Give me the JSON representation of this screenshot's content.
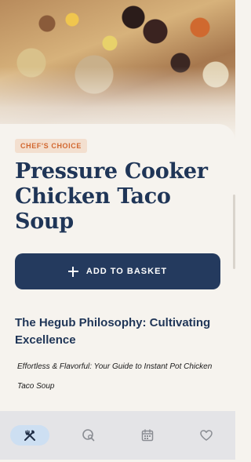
{
  "recipe": {
    "badge": "CHEF'S CHOICE",
    "title": "Pressure Cooker Chicken Taco Soup",
    "add_button_label": "ADD TO BASKET",
    "section_title": "The Hegub Philosophy: Cultivating Excellence",
    "subtitle": "Effortless & Flavorful: Your Guide to Instant Pot Chicken Taco Soup"
  },
  "bottom_nav": {
    "items": [
      {
        "icon": "utensils-icon",
        "active": true
      },
      {
        "icon": "search-recipes-icon",
        "active": false
      },
      {
        "icon": "calendar-icon",
        "active": false
      },
      {
        "icon": "heart-icon",
        "active": false
      }
    ]
  },
  "colors": {
    "primary": "#243a5e",
    "title": "#1f3557",
    "badge_text": "#d2672f",
    "badge_bg": "#f3dfcf",
    "background": "#f6f3ee",
    "nav_bg": "#e4e4e7",
    "nav_active_pill": "#cddff2"
  }
}
